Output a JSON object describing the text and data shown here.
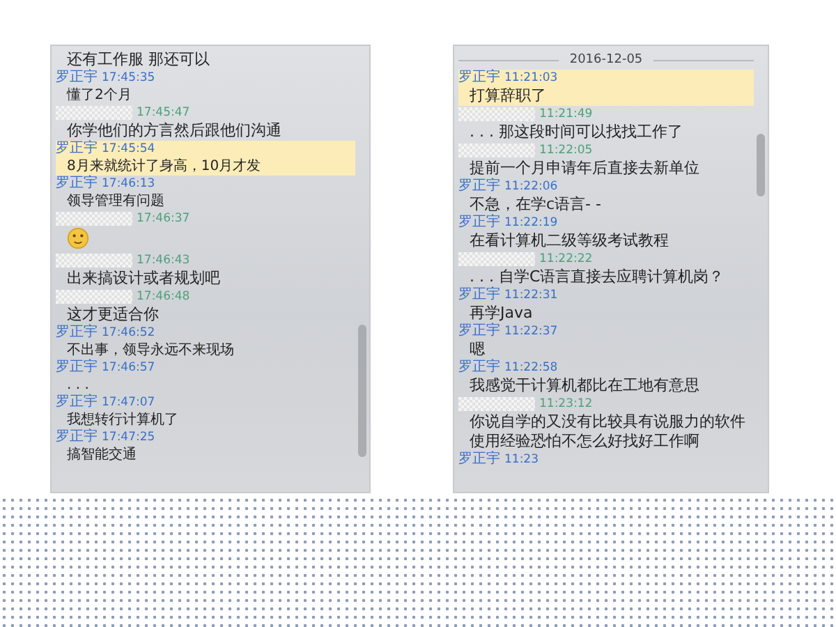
{
  "left_chat": {
    "messages": [
      {
        "kind": "bigtext",
        "text": "还有工作服 那还可以",
        "highlighted": false
      },
      {
        "kind": "smalltext",
        "name": "罗正宇",
        "time": "17:45:35",
        "text": "懂了2个月",
        "highlighted": false
      },
      {
        "kind": "bigtext",
        "time": "17:45:47",
        "text": "你学他们的方言然后跟他们沟通",
        "highlighted": false
      },
      {
        "kind": "smalltext",
        "name": "罗正宇",
        "time": "17:45:54",
        "text": "8月来就统计了身高，10月才发",
        "highlighted": true
      },
      {
        "kind": "smalltext",
        "name": "罗正宇",
        "time": "17:46:13",
        "text": "领导管理有问题",
        "highlighted": false
      },
      {
        "kind": "emoji",
        "time": "17:46:37",
        "highlighted": false
      },
      {
        "kind": "bigtext",
        "time": "17:46:43",
        "text": "出来搞设计或者规划吧",
        "highlighted": false
      },
      {
        "kind": "bigtext",
        "time": "17:46:48",
        "text": "这才更适合你",
        "highlighted": false
      },
      {
        "kind": "smalltext",
        "name": "罗正宇",
        "time": "17:46:52",
        "text": "不出事，领导永远不来现场",
        "highlighted": false
      },
      {
        "kind": "smalltext",
        "name": "罗正宇",
        "time": "17:46:57",
        "text": ". . .",
        "highlighted": false
      },
      {
        "kind": "smalltext",
        "name": "罗正宇",
        "time": "17:47:07",
        "text": "我想转行计算机了",
        "highlighted": false
      },
      {
        "kind": "smalltext",
        "name": "罗正宇",
        "time": "17:47:25",
        "text": "搞智能交通",
        "highlighted": false
      }
    ]
  },
  "right_chat": {
    "date": "2016-12-05",
    "messages": [
      {
        "kind": "bigtext",
        "name": "罗正宇",
        "time": "11:21:03",
        "text": "打算辞职了",
        "highlighted": true
      },
      {
        "kind": "bigtext",
        "time": "11:21:49",
        "text": ". . . 那这段时间可以找找工作了",
        "highlighted": false
      },
      {
        "kind": "bigtext",
        "time": "11:22:05",
        "text": "提前一个月申请年后直接去新单位",
        "highlighted": false
      },
      {
        "kind": "bigtext",
        "name": "罗正宇",
        "time": "11:22:06",
        "text": "不急，在学c语言- -",
        "highlighted": false
      },
      {
        "kind": "bigtext",
        "name": "罗正宇",
        "time": "11:22:19",
        "text": "在看计算机二级等级考试教程",
        "highlighted": false
      },
      {
        "kind": "bigtext",
        "time": "11:22:22",
        "text": ". . . 自学C语言直接去应聘计算机岗？",
        "highlighted": false
      },
      {
        "kind": "bigtext",
        "name": "罗正宇",
        "time": "11:22:31",
        "text": "再学Java",
        "highlighted": false
      },
      {
        "kind": "bigtext",
        "name": "罗正宇",
        "time": "11:22:37",
        "text": "嗯",
        "highlighted": false
      },
      {
        "kind": "bigtext",
        "name": "罗正宇",
        "time": "11:22:58",
        "text": "我感觉干计算机都比在工地有意思",
        "highlighted": false
      },
      {
        "kind": "bigtext",
        "time": "11:23:12",
        "text": "你说自学的又没有比较具有说服力的软件使用经验恐怕不怎么好找好工作啊",
        "highlighted": false
      },
      {
        "kind": "meta",
        "name": "罗正宇",
        "time": "11:23",
        "highlighted": false
      }
    ]
  }
}
